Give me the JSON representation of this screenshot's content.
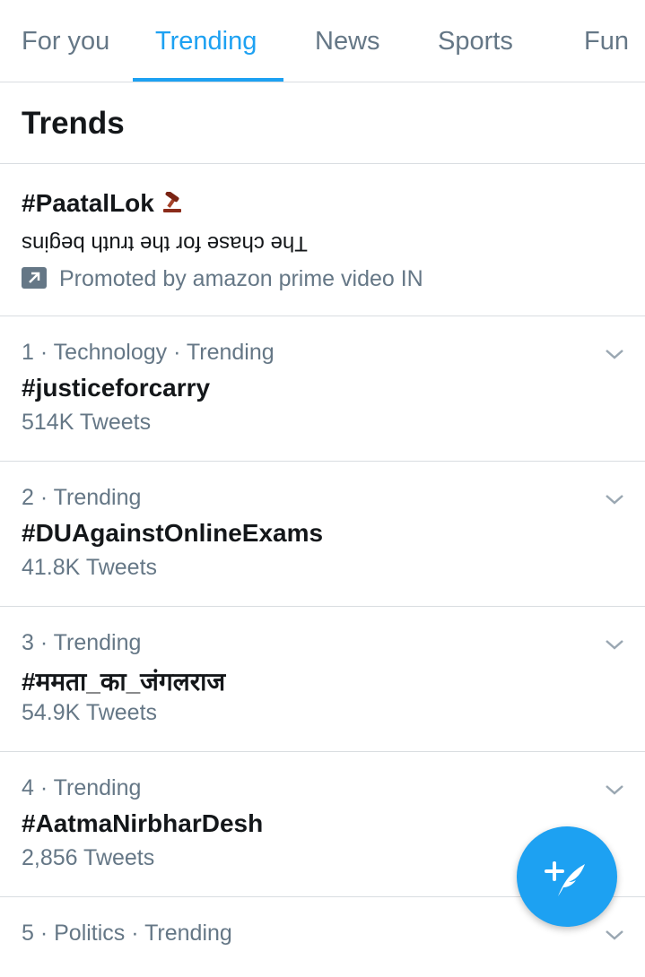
{
  "tabs": [
    {
      "label": "For you",
      "active": false
    },
    {
      "label": "Trending",
      "active": true
    },
    {
      "label": "News",
      "active": false
    },
    {
      "label": "Sports",
      "active": false
    },
    {
      "label": "Fun",
      "active": false
    }
  ],
  "section_title": "Trends",
  "promoted": {
    "title": "#PaatalLok",
    "emoji_icon": "gavel-icon",
    "description": "The chase for the truth begins",
    "promoted_by": "Promoted by amazon prime video IN",
    "promoted_icon": "promoted-arrow-icon"
  },
  "trends": [
    {
      "meta": "1 · Technology · Trending",
      "name": "#justiceforcarry",
      "count": "514K Tweets"
    },
    {
      "meta": "2 · Trending",
      "name": "#DUAgainstOnlineExams",
      "count": "41.8K Tweets"
    },
    {
      "meta": "3 · Trending",
      "name": "#ममता_का_जंगलराज",
      "count": "54.9K Tweets"
    },
    {
      "meta": "4 · Trending",
      "name": "#AatmaNirbharDesh",
      "count": "2,856 Tweets"
    },
    {
      "meta": "5 · Politics · Trending",
      "name": "",
      "count": ""
    }
  ],
  "fab": {
    "icon": "compose-tweet-icon"
  },
  "colors": {
    "accent": "#1da1f2",
    "text_primary": "#14171a",
    "text_secondary": "#657786",
    "divider": "#d9dde1"
  }
}
